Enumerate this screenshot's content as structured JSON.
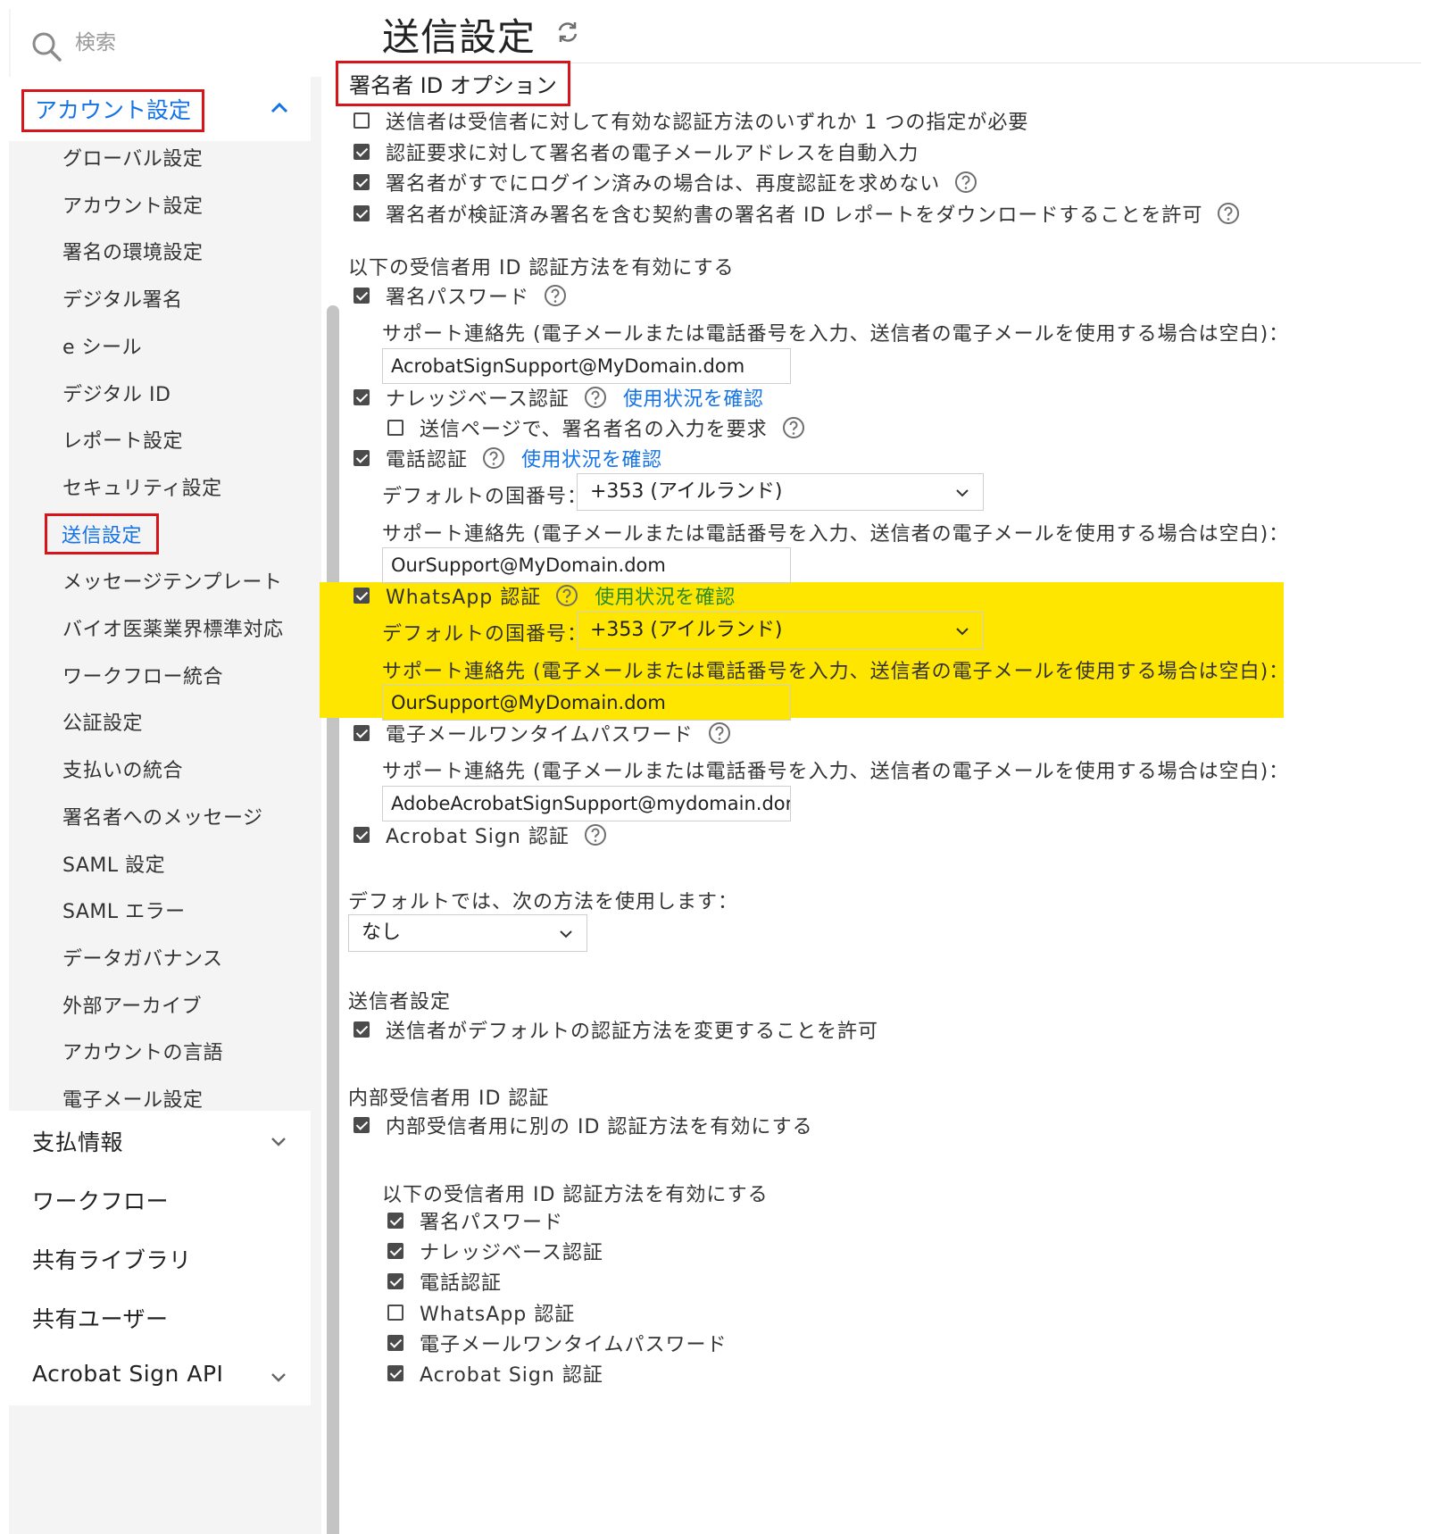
{
  "colors": {
    "accent": "#1473e6",
    "highlight": "#ffe600",
    "annotation_red": "#d7141a",
    "sidebar_bg": "#f4f4f4"
  },
  "sidebar": {
    "search_placeholder": "検索",
    "account_header": "アカウント設定",
    "sub_items": [
      "グローバル設定",
      "アカウント設定",
      "署名の環境設定",
      "デジタル署名",
      "e シール",
      "デジタル ID",
      "レポート設定",
      "セキュリティ設定",
      "送信設定",
      "メッセージテンプレート",
      "バイオ医薬業界標準対応",
      "ワークフロー統合",
      "公証設定",
      "支払いの統合",
      "署名者へのメッセージ",
      "SAML 設定",
      "SAML エラー",
      "データガバナンス",
      "外部アーカイブ",
      "アカウントの言語",
      "電子メール設定"
    ],
    "active_item": "送信設定",
    "sections": [
      {
        "label": "支払情報",
        "has_chevron": true
      },
      {
        "label": "ワークフロー",
        "has_chevron": false
      },
      {
        "label": "共有ライブラリ",
        "has_chevron": false
      },
      {
        "label": "共有ユーザー",
        "has_chevron": false
      },
      {
        "label": "Acrobat Sign API",
        "has_chevron": true
      }
    ]
  },
  "main": {
    "title": "送信設定",
    "signer_id_options": {
      "heading": "署名者 ID オプション",
      "options": [
        {
          "label": "送信者は受信者に対して有効な認証方法のいずれか 1 つの指定が必要",
          "checked": false,
          "help": false
        },
        {
          "label": "認証要求に対して署名者の電子メールアドレスを自動入力",
          "checked": true,
          "help": false
        },
        {
          "label": "署名者がすでにログイン済みの場合は、再度認証を求めない",
          "checked": true,
          "help": true
        },
        {
          "label": "署名者が検証済み署名を含む契約書の署名者 ID レポートをダウンロードすることを許可",
          "checked": true,
          "help": true
        }
      ]
    },
    "recipient_methods": {
      "heading": "以下の受信者用 ID 認証方法を有効にする",
      "support_label": "サポート連絡先 (電子メールまたは電話番号を入力、送信者の電子メールを使用する場合は空白)：",
      "country_label": "デフォルトの国番号：",
      "usage_link": "使用状況を確認",
      "password": {
        "label": "署名パスワード",
        "checked": true,
        "support_value": "AcrobatSignSupport@MyDomain.dom"
      },
      "kba": {
        "label": "ナレッジベース認証",
        "checked": true,
        "sub_option": {
          "label": "送信ページで、署名者名の入力を要求",
          "checked": false
        }
      },
      "phone": {
        "label": "電話認証",
        "checked": true,
        "country_value": "+353 (アイルランド)",
        "support_value": "OurSupport@MyDomain.dom"
      },
      "whatsapp": {
        "label": "WhatsApp 認証",
        "checked": true,
        "country_value": "+353 (アイルランド)",
        "support_value": "OurSupport@MyDomain.dom"
      },
      "email_otp": {
        "label": "電子メールワンタイムパスワード",
        "checked": true,
        "support_value": "AdobeAcrobatSignSupport@mydomain.dor"
      },
      "acrobat_sign": {
        "label": "Acrobat Sign 認証",
        "checked": true
      }
    },
    "default_method": {
      "label": "デフォルトでは、次の方法を使用します：",
      "value": "なし"
    },
    "sender_settings": {
      "heading": "送信者設定",
      "option": {
        "label": "送信者がデフォルトの認証方法を変更することを許可",
        "checked": true
      }
    },
    "internal_auth": {
      "heading": "内部受信者用 ID 認証",
      "enable": {
        "label": "内部受信者用に別の ID 認証方法を有効にする",
        "checked": true
      },
      "methods_heading": "以下の受信者用 ID 認証方法を有効にする",
      "methods": [
        {
          "label": "署名パスワード",
          "checked": true
        },
        {
          "label": "ナレッジベース認証",
          "checked": true
        },
        {
          "label": "電話認証",
          "checked": true
        },
        {
          "label": "WhatsApp 認証",
          "checked": false
        },
        {
          "label": "電子メールワンタイムパスワード",
          "checked": true
        },
        {
          "label": "Acrobat Sign 認証",
          "checked": true
        }
      ]
    }
  }
}
